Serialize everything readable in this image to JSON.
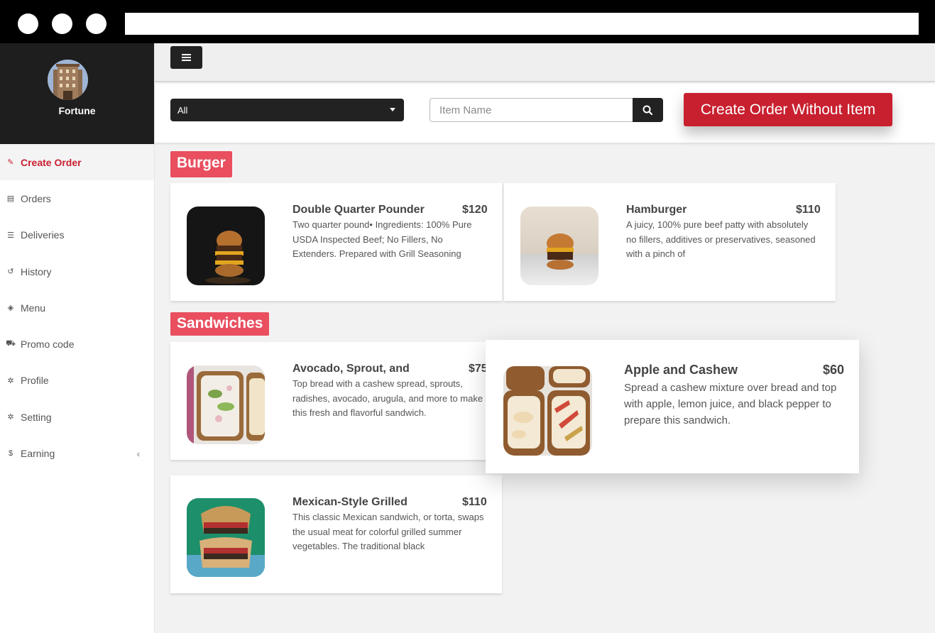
{
  "profile": {
    "name": "Fortune"
  },
  "sidebar": {
    "items": [
      {
        "label": "Create Order",
        "icon": "edit-icon",
        "active": true
      },
      {
        "label": "Orders",
        "icon": "list-icon"
      },
      {
        "label": "Deliveries",
        "icon": "list-bars-icon"
      },
      {
        "label": "History",
        "icon": "history-icon"
      },
      {
        "label": "Menu",
        "icon": "box-icon"
      },
      {
        "label": "Promo code",
        "icon": "cart-icon"
      },
      {
        "label": "Profile",
        "icon": "gear-icon"
      },
      {
        "label": "Setting",
        "icon": "gear-icon"
      },
      {
        "label": "Earning",
        "icon": "dollar-icon",
        "chevron": "‹"
      }
    ]
  },
  "filter": {
    "category_value": "All",
    "search_placeholder": "Item Name",
    "create_button_label": "Create Order Without Item"
  },
  "categories": [
    {
      "title": "Burger",
      "items": [
        {
          "name": "Double Quarter Pounder",
          "price": "$120",
          "description": "Two quarter pound• Ingredients: 100% Pure USDA Inspected Beef; No Fillers, No Extenders. Prepared with Grill Seasoning"
        },
        {
          "name": "Hamburger",
          "price": "$110",
          "description": "A juicy, 100% pure beef patty with absolutely no fillers, additives or preservatives, seasoned with a pinch of"
        }
      ]
    },
    {
      "title": "Sandwiches",
      "items": [
        {
          "name": "Avocado, Sprout, and",
          "price": "$75",
          "description": "Top bread with a cashew spread, sprouts, radishes, avocado, arugula, and more to make this fresh and flavorful sandwich."
        },
        {
          "name": "Apple and Cashew",
          "price": "$60",
          "description": "Spread a cashew mixture over bread and top with apple, lemon juice, and black pepper to prepare this sandwich."
        },
        {
          "name": "Mexican-Style Grilled",
          "price": "$110",
          "description": "This classic Mexican sandwich, or torta, swaps the usual meat for colorful grilled summer vegetables. The traditional black"
        }
      ]
    }
  ],
  "colors": {
    "accent": "#c8202f",
    "category_badge": "#e94f5f",
    "dark": "#222222"
  }
}
